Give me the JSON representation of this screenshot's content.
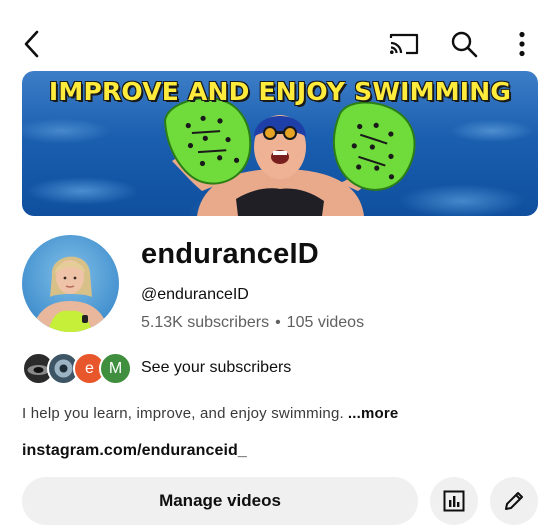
{
  "topbar": {
    "icons": [
      "back-arrow-icon",
      "cast-icon",
      "search-icon",
      "more-vertical-icon"
    ]
  },
  "banner": {
    "title": "IMPROVE AND ENJOY SWIMMING",
    "colors": {
      "title": "#ffeb3b",
      "water": "#1b5fb0",
      "paddles": "#6fdc3b"
    }
  },
  "channel": {
    "name": "enduranceID",
    "handle": "@enduranceID",
    "subscribers": "5.13K subscribers",
    "separator": "•",
    "videos": "105 videos"
  },
  "subscribers_row": {
    "avatars": [
      {
        "kind": "image",
        "color": "#2b2b2b"
      },
      {
        "kind": "image",
        "color": "#3e5566"
      },
      {
        "kind": "letter",
        "letter": "e",
        "color": "#e8572b"
      },
      {
        "kind": "letter",
        "letter": "M",
        "color": "#3f8f3f"
      }
    ],
    "label": "See your subscribers"
  },
  "description": {
    "text": "I help you learn, improve, and enjoy swimming.",
    "more_label": "...more"
  },
  "link": {
    "text": "instagram.com/enduranceid_"
  },
  "actions": {
    "manage_label": "Manage videos",
    "icons": [
      "analytics-icon",
      "edit-pencil-icon"
    ]
  }
}
